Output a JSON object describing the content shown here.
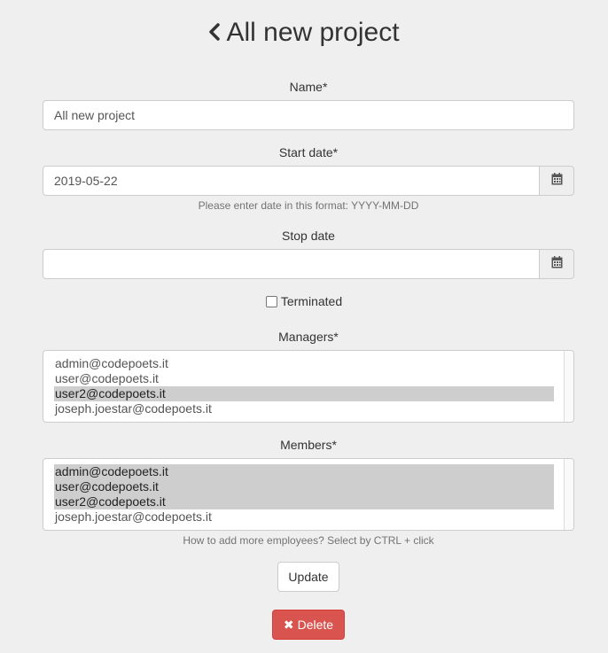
{
  "header": {
    "title": "All new project",
    "back_icon": "chevron-left-icon"
  },
  "form": {
    "name": {
      "label": "Name*",
      "value": "All new project"
    },
    "start_date": {
      "label": "Start date*",
      "value": "2019-05-22",
      "help": "Please enter date in this format: YYYY-MM-DD",
      "icon": "calendar-icon"
    },
    "stop_date": {
      "label": "Stop date",
      "value": "",
      "icon": "calendar-icon"
    },
    "terminated": {
      "label": "Terminated",
      "checked": false
    },
    "managers": {
      "label": "Managers*",
      "options": [
        {
          "text": "admin@codepoets.it",
          "selected": false
        },
        {
          "text": "user@codepoets.it",
          "selected": false
        },
        {
          "text": "user2@codepoets.it",
          "selected": true
        },
        {
          "text": "joseph.joestar@codepoets.it",
          "selected": false
        }
      ]
    },
    "members": {
      "label": "Members*",
      "options": [
        {
          "text": "admin@codepoets.it",
          "selected": true
        },
        {
          "text": "user@codepoets.it",
          "selected": true
        },
        {
          "text": "user2@codepoets.it",
          "selected": true
        },
        {
          "text": "joseph.joestar@codepoets.it",
          "selected": false
        }
      ],
      "help": "How to add more employees? Select by CTRL + click"
    }
  },
  "actions": {
    "update_label": "Update",
    "delete_label": "Delete",
    "delete_icon": "times-icon"
  },
  "colors": {
    "danger": "#d9534f",
    "selected_option": "#cecece",
    "background": "#efefef"
  }
}
